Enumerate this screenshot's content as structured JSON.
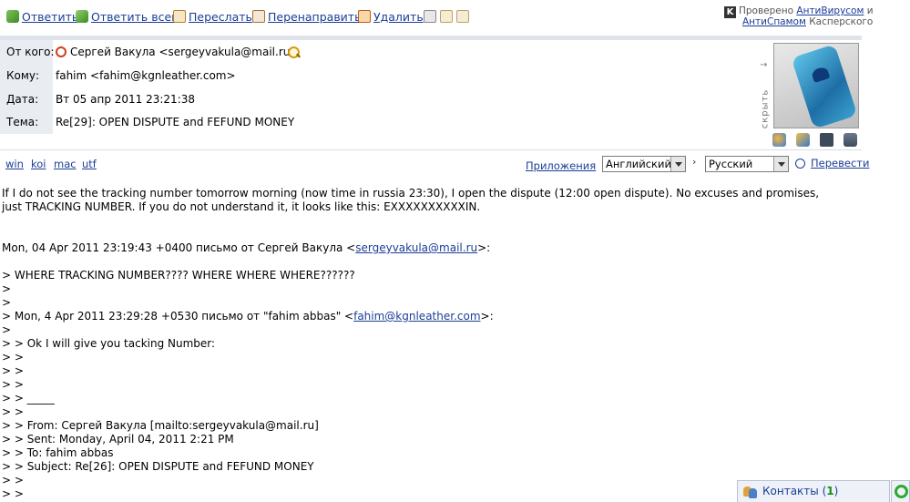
{
  "toolbar": {
    "reply": "Ответить",
    "reply_all": "Ответить всем",
    "forward": "Переслать",
    "redirect": "Перенаправить",
    "delete": "Удалить",
    "icons": [
      "reply-icon",
      "reply-all-icon",
      "forward-icon",
      "redirect-icon",
      "delete-icon",
      "print-icon",
      "rfc-icon",
      "save-icon"
    ]
  },
  "kaspersky": {
    "logo": "K",
    "prefix": "Проверено ",
    "antivirus": "АнтиВирусом",
    "and": " и",
    "antispam": "АнтиСпамом",
    "suffix": " Касперского"
  },
  "header": {
    "from_label": "От кого:",
    "from_value": "Сергей Вакула <sergeyvakula@mail.ru>",
    "to_label": "Кому:",
    "to_value": "fahim <fahim@kgnleather.com>",
    "date_label": "Дата:",
    "date_value": "Вт 05 апр 2011 23:21:38",
    "subject_label": "Тема:",
    "subject_value": "Re[29]: OPEN DISPUTE and FEFUND MONEY",
    "hide_label": "скрыть",
    "hide_arrow": "→"
  },
  "encodings": [
    "win",
    "koi",
    "mac",
    "utf"
  ],
  "translate": {
    "attachments_label": "Приложения",
    "source_lang": "Английский",
    "target_lang": "Русский",
    "separator": "›",
    "translate_label": "Перевести"
  },
  "body": {
    "intro": "If I do not see the tracking number tomorrow morning (now time in russia 23:30), I open the dispute (12:00 open dispute). No excuses and promises, just TRACKING NUMBER. If you do not understand it, it looks like this: EXXXXXXXXXXIN.",
    "reply1_prefix": "Mon, 04 Apr 2011 23:19:43 +0400 письмо от Сергей Вакула <",
    "reply1_email": "sergeyvakula@mail.ru",
    "reply1_suffix": ">:",
    "q1": "> WHERE TRACKING NUMBER???? WHERE WHERE WHERE??????",
    "q2": ">",
    "q3": ">",
    "reply2_prefix": "> Mon, 4 Apr 2011 23:29:28 +0530 письмо от \"fahim abbas\" <",
    "reply2_email": "fahim@kgnleather.com",
    "reply2_suffix": ">:",
    "q4": ">",
    "q5": "> > Ok I will give you tacking Number:",
    "q6": "> >",
    "q7": "> >",
    "q8": "> >",
    "q9": "> > _____",
    "q10": "> >",
    "q11": "> > From: Сергей Вакула [mailto:sergeyvakula@mail.ru]",
    "q12": "> > Sent: Monday, April 04, 2011 2:21 PM",
    "q13": "> > To: fahim abbas",
    "q14": "> > Subject: Re[26]: OPEN DISPUTE and FEFUND MONEY",
    "q15": "> >",
    "q16": "> >"
  },
  "contacts": {
    "label": "Контакты (",
    "count": "1",
    "close": ")"
  },
  "colors": {
    "link": "#1a3d96",
    "header_label_bg": "#e9ecf1",
    "separator": "#dfe3ea",
    "contacts_count": "#1a8a1a"
  }
}
